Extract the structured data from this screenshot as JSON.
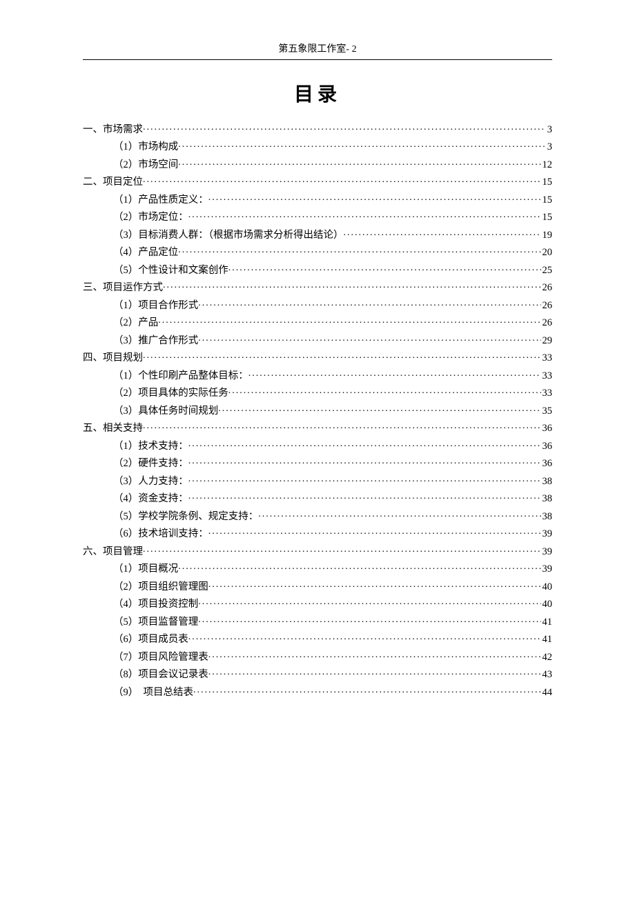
{
  "header": "第五象限工作室- 2",
  "title": "目录",
  "toc": [
    {
      "level": 1,
      "label": "一、市场需求",
      "page": "3"
    },
    {
      "level": 2,
      "label": "（1）市场构成",
      "page": "3"
    },
    {
      "level": 2,
      "label": "（2）市场空间",
      "page": "12"
    },
    {
      "level": 1,
      "label": "二、项目定位",
      "page": "15"
    },
    {
      "level": 2,
      "label": "（1）产品性质定义：",
      "page": "15"
    },
    {
      "level": 2,
      "label": "（2）市场定位：",
      "page": "15"
    },
    {
      "level": 2,
      "label": "（3）目标消费人群：（根据市场需求分析得出结论）",
      "page": "19"
    },
    {
      "level": 2,
      "label": "（4）产品定位",
      "page": "20"
    },
    {
      "level": 2,
      "label": "（5）个性设计和文案创作",
      "page": "25"
    },
    {
      "level": 1,
      "label": "三、项目运作方式",
      "page": "26"
    },
    {
      "level": 2,
      "label": "（1）项目合作形式",
      "page": "26"
    },
    {
      "level": 2,
      "label": "（2）产品",
      "page": "26"
    },
    {
      "level": 2,
      "label": "（3）推广合作形式",
      "page": "29"
    },
    {
      "level": 1,
      "label": "四、项目规划",
      "page": "33"
    },
    {
      "level": 2,
      "label": "（1）个性印刷产品整体目标：",
      "page": "33"
    },
    {
      "level": 2,
      "label": "（2）项目具体的实际任务",
      "page": "33"
    },
    {
      "level": 2,
      "label": "（3）具体任务时间规划",
      "page": "35"
    },
    {
      "level": 1,
      "label": "五、相关支持",
      "page": "36"
    },
    {
      "level": 2,
      "label": "（1）技术支持：",
      "page": "36"
    },
    {
      "level": 2,
      "label": "（2）硬件支持：",
      "page": "36"
    },
    {
      "level": 2,
      "label": "（3）人力支持：",
      "page": "38"
    },
    {
      "level": 2,
      "label": "（4）资金支持：",
      "page": "38"
    },
    {
      "level": 2,
      "label": "（5）学校学院条例、规定支持：",
      "page": "38"
    },
    {
      "level": 2,
      "label": "（6）技术培训支持：",
      "page": "39"
    },
    {
      "level": 1,
      "label": "六、项目管理",
      "page": "39"
    },
    {
      "level": 2,
      "label": "（1）项目概况",
      "page": "39"
    },
    {
      "level": 2,
      "label": "（2）项目组织管理图",
      "page": "40"
    },
    {
      "level": 2,
      "label": "（4）项目投资控制",
      "page": "40"
    },
    {
      "level": 2,
      "label": "（5）项目监督管理",
      "page": "41"
    },
    {
      "level": 2,
      "label": "（6）项目成员表",
      "page": "41"
    },
    {
      "level": 2,
      "label": "（7）项目风险管理表",
      "page": "42"
    },
    {
      "level": 2,
      "label": "（8）项目会议记录表",
      "page": "43"
    },
    {
      "level": 2,
      "label": "（9）　项目总结表",
      "page": "44"
    }
  ]
}
